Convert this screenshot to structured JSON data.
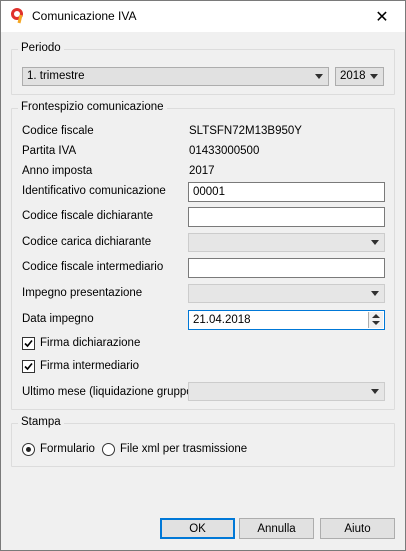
{
  "window": {
    "title": "Comunicazione IVA",
    "close_glyph": "✕"
  },
  "periodo": {
    "legend": "Periodo",
    "period_value": "1. trimestre",
    "year_value": "2018"
  },
  "frontespizio": {
    "legend": "Frontespizio comunicazione",
    "codice_fiscale_label": "Codice fiscale",
    "codice_fiscale_value": "SLTSFN72M13B950Y",
    "partita_iva_label": "Partita IVA",
    "partita_iva_value": "01433000500",
    "anno_imposta_label": "Anno imposta",
    "anno_imposta_value": "2017",
    "identificativo_label": "Identificativo comunicazione",
    "identificativo_value": "00001",
    "cf_dichiarante_label": "Codice fiscale dichiarante",
    "cf_dichiarante_value": "",
    "carica_dichiarante_label": "Codice carica dichiarante",
    "carica_dichiarante_value": "",
    "cf_intermediario_label": "Codice fiscale intermediario",
    "cf_intermediario_value": "",
    "impegno_label": "Impegno presentazione",
    "impegno_value": "",
    "data_impegno_label": "Data impegno",
    "data_impegno_value": "21.04.2018",
    "firma_dichiarazione_label": "Firma dichiarazione",
    "firma_dichiarazione_checked": true,
    "firma_intermediario_label": "Firma intermediario",
    "firma_intermediario_checked": true,
    "ultimo_mese_label": "Ultimo mese (liquidazione gruppo)",
    "ultimo_mese_value": ""
  },
  "stampa": {
    "legend": "Stampa",
    "formulario_label": "Formulario",
    "xml_label": "File xml per trasmissione",
    "selected": "formulario"
  },
  "buttons": {
    "ok": "OK",
    "annulla": "Annulla",
    "aiuto": "Aiuto"
  },
  "colors": {
    "accent": "#0078d7",
    "app_icon_red": "#e0312c",
    "app_icon_orange": "#f5a623"
  }
}
